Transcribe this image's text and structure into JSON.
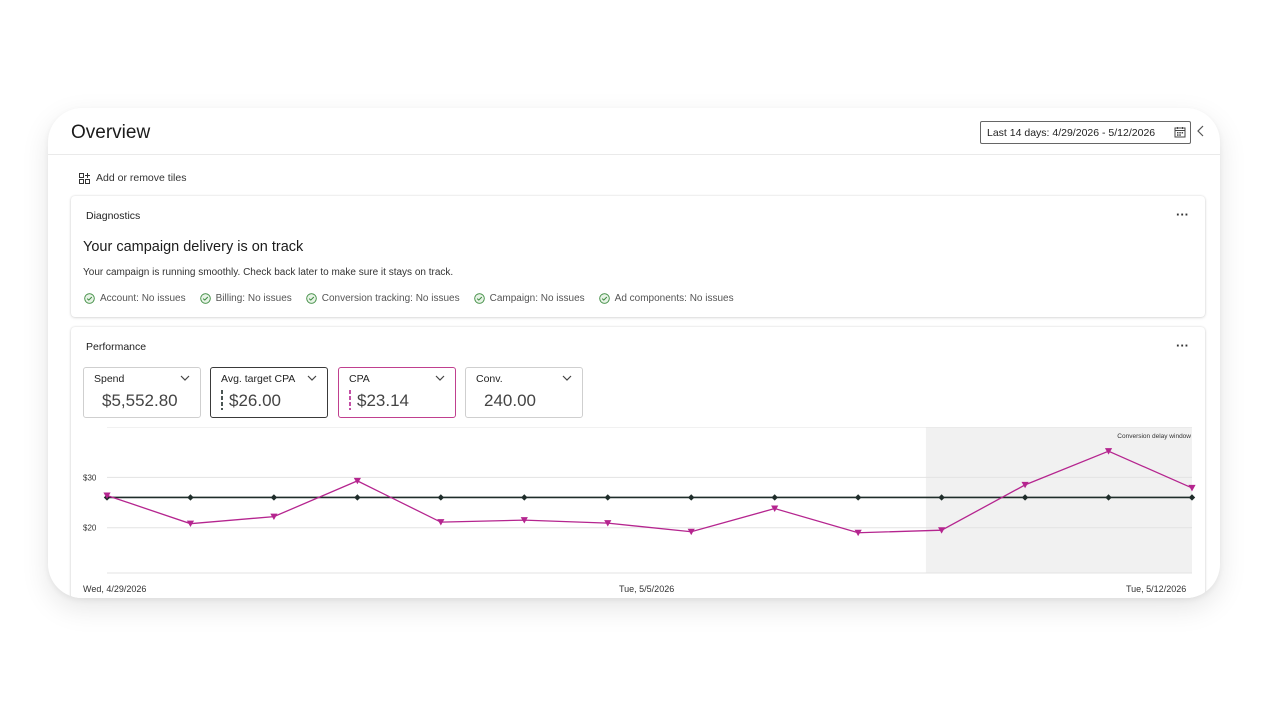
{
  "page": {
    "title": "Overview",
    "date_range": "Last 14 days: 4/29/2026 - 5/12/2026"
  },
  "toolbar": {
    "add_tiles_label": "Add or remove tiles"
  },
  "diagnostics": {
    "title": "Diagnostics",
    "more": "···",
    "headline": "Your campaign delivery is on track",
    "subtext": "Your campaign is running smoothly. Check back later to make sure it stays on track.",
    "issues": [
      {
        "label": "Account: No issues"
      },
      {
        "label": "Billing: No issues"
      },
      {
        "label": "Conversion tracking: No issues"
      },
      {
        "label": "Campaign: No issues"
      },
      {
        "label": "Ad components: No issues"
      }
    ],
    "status_color": "#3b8a3e"
  },
  "performance": {
    "title": "Performance",
    "more": "···",
    "kpis": [
      {
        "label": "Spend",
        "value": "$5,552.80"
      },
      {
        "label": "Avg. target CPA",
        "value": "$26.00"
      },
      {
        "label": "CPA",
        "value": "$23.14"
      },
      {
        "label": "Conv.",
        "value": "240.00"
      }
    ]
  },
  "chart_data": {
    "type": "line",
    "x": [
      "4/29/2026",
      "4/30/2026",
      "5/1/2026",
      "5/2/2026",
      "5/3/2026",
      "5/4/2026",
      "5/5/2026",
      "5/6/2026",
      "5/7/2026",
      "5/8/2026",
      "5/9/2026",
      "5/10/2026",
      "5/11/2026",
      "5/12/2026"
    ],
    "x_tick_labels": [
      "Wed, 4/29/2026",
      "Tue, 5/5/2026",
      "Tue, 5/12/2026"
    ],
    "y_tick_labels": [
      "$30",
      "$20"
    ],
    "ylim": [
      11,
      40
    ],
    "series": [
      {
        "name": "Avg. target CPA",
        "color": "#1f2d2a",
        "marker": "diamond",
        "values": [
          26,
          26,
          26,
          26,
          26,
          26,
          26,
          26,
          26,
          26,
          26,
          26,
          26,
          26
        ]
      },
      {
        "name": "CPA",
        "color": "#b5258f",
        "marker": "triangle-down",
        "values": [
          26.4,
          20.8,
          22.2,
          29.3,
          21.1,
          21.5,
          20.9,
          19.2,
          23.8,
          19.0,
          19.5,
          28.5,
          35.2,
          27.9
        ]
      }
    ],
    "shaded_region": {
      "label": "Conversion delay window",
      "start": "5/9/2026",
      "end": "5/12/2026"
    },
    "grid": true
  }
}
